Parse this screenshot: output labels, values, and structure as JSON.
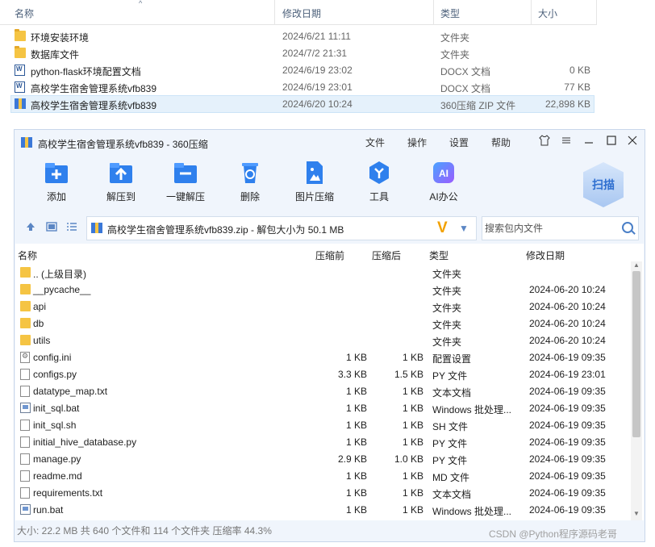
{
  "explorer": {
    "columns": {
      "name": "名称",
      "modified": "修改日期",
      "type": "类型",
      "size": "大小"
    },
    "rows": [
      {
        "name": "环境安装环境",
        "date": "2024/6/21 11:11",
        "type": "文件夹",
        "size": "",
        "icon": "folder-icon"
      },
      {
        "name": "数据库文件",
        "date": "2024/7/2 21:31",
        "type": "文件夹",
        "size": "",
        "icon": "folder-icon"
      },
      {
        "name": "python-flask环境配置文档",
        "date": "2024/6/19 23:02",
        "type": "DOCX 文档",
        "size": "0 KB",
        "icon": "word-doc-icon"
      },
      {
        "name": "高校学生宿舍管理系统vfb839",
        "date": "2024/6/19 23:01",
        "type": "DOCX 文档",
        "size": "77 KB",
        "icon": "word-doc-icon"
      },
      {
        "name": "高校学生宿舍管理系统vfb839",
        "date": "2024/6/20 10:24",
        "type": "360压缩 ZIP 文件",
        "size": "22,898 KB",
        "icon": "zip-icon",
        "selected": true
      }
    ]
  },
  "zip_window": {
    "title": "高校学生宿舍管理系统vfb839 - 360压缩",
    "menu": [
      "文件",
      "操作",
      "设置",
      "帮助"
    ],
    "toolbar": [
      "添加",
      "解压到",
      "一键解压",
      "删除",
      "图片压缩",
      "工具",
      "AI办公"
    ],
    "scan_label": "扫描",
    "path": "高校学生宿舍管理系统vfb839.zip - 解包大小为 50.1 MB",
    "search_placeholder": "搜索包内文件",
    "list_columns": {
      "name": "名称",
      "compressed": "压缩前",
      "packed": "压缩后",
      "type": "类型",
      "modified": "修改日期"
    },
    "files": [
      {
        "name": ".. (上级目录)",
        "before": "",
        "after": "",
        "type": "文件夹",
        "date": "",
        "icon": "folder-icon"
      },
      {
        "name": "__pycache__",
        "before": "",
        "after": "",
        "type": "文件夹",
        "date": "2024-06-20 10:24",
        "icon": "folder-icon"
      },
      {
        "name": "api",
        "before": "",
        "after": "",
        "type": "文件夹",
        "date": "2024-06-20 10:24",
        "icon": "folder-icon"
      },
      {
        "name": "db",
        "before": "",
        "after": "",
        "type": "文件夹",
        "date": "2024-06-20 10:24",
        "icon": "folder-icon"
      },
      {
        "name": "utils",
        "before": "",
        "after": "",
        "type": "文件夹",
        "date": "2024-06-20 10:24",
        "icon": "folder-icon"
      },
      {
        "name": "config.ini",
        "before": "1 KB",
        "after": "1 KB",
        "type": "配置设置",
        "date": "2024-06-19 09:35",
        "icon": "config-file-icon"
      },
      {
        "name": "configs.py",
        "before": "3.3 KB",
        "after": "1.5 KB",
        "type": "PY 文件",
        "date": "2024-06-19 23:01",
        "icon": "file-icon"
      },
      {
        "name": "datatype_map.txt",
        "before": "1 KB",
        "after": "1 KB",
        "type": "文本文档",
        "date": "2024-06-19 09:35",
        "icon": "file-icon"
      },
      {
        "name": "init_sql.bat",
        "before": "1 KB",
        "after": "1 KB",
        "type": "Windows 批处理...",
        "date": "2024-06-19 09:35",
        "icon": "batch-file-icon"
      },
      {
        "name": "init_sql.sh",
        "before": "1 KB",
        "after": "1 KB",
        "type": "SH 文件",
        "date": "2024-06-19 09:35",
        "icon": "file-icon"
      },
      {
        "name": "initial_hive_database.py",
        "before": "1 KB",
        "after": "1 KB",
        "type": "PY 文件",
        "date": "2024-06-19 09:35",
        "icon": "file-icon"
      },
      {
        "name": "manage.py",
        "before": "2.9 KB",
        "after": "1.0 KB",
        "type": "PY 文件",
        "date": "2024-06-19 09:35",
        "icon": "file-icon"
      },
      {
        "name": "readme.md",
        "before": "1 KB",
        "after": "1 KB",
        "type": "MD 文件",
        "date": "2024-06-19 09:35",
        "icon": "file-icon"
      },
      {
        "name": "requirements.txt",
        "before": "1 KB",
        "after": "1 KB",
        "type": "文本文档",
        "date": "2024-06-19 09:35",
        "icon": "file-icon"
      },
      {
        "name": "run.bat",
        "before": "1 KB",
        "after": "1 KB",
        "type": "Windows 批处理...",
        "date": "2024-06-19 09:35",
        "icon": "batch-file-icon"
      }
    ],
    "status": "大小: 22.2 MB 共 640 个文件和 114 个文件夹 压缩率 44.3%"
  },
  "watermark": "CSDN @Python程序源码老哥",
  "colors": {
    "accent": "#3b78d8",
    "selection": "#e5f1fb",
    "window_bg": "#f0f5fc"
  }
}
